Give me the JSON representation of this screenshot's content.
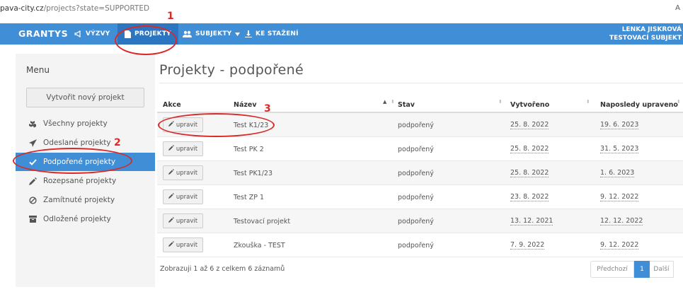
{
  "browser": {
    "url_host": "pava-city.cz",
    "url_path": "/projects?state=SUPPORTED",
    "right_glyph": "A"
  },
  "navbar": {
    "brand": "GRANTYS",
    "items": [
      {
        "label": "VÝZVY",
        "icon": "megaphone-icon"
      },
      {
        "label": "PROJEKTY",
        "icon": "document-icon"
      },
      {
        "label": "SUBJEKTY",
        "icon": "users-icon"
      },
      {
        "label": "KE STAŽENÍ",
        "icon": "download-icon"
      }
    ],
    "user_name": "LENKA JISKROVÁ",
    "user_org": "TESTOVACÍ SUBJEKT"
  },
  "sidebar": {
    "title": "Menu",
    "new_button": "Vytvořit nový projekt",
    "items": [
      {
        "label": "Všechny projekty",
        "icon": "cubes-icon"
      },
      {
        "label": "Odeslané projekty",
        "icon": "send-icon"
      },
      {
        "label": "Podpořené projekty",
        "icon": "check-icon"
      },
      {
        "label": "Rozepsané projekty",
        "icon": "pencil-icon"
      },
      {
        "label": "Zamítnuté projekty",
        "icon": "ban-icon"
      },
      {
        "label": "Odložené projekty",
        "icon": "archive-icon"
      }
    ]
  },
  "main": {
    "title": "Projekty - podpořené",
    "table": {
      "headers": [
        "Akce",
        "Název",
        "Stav",
        "Vytvořeno",
        "Naposledy upraveno"
      ],
      "edit_label": "upravit",
      "rows": [
        {
          "name": "Test K1/23",
          "state": "podpořený",
          "created": "25. 8. 2022",
          "updated": "19. 6. 2023"
        },
        {
          "name": "Test PK 2",
          "state": "podpořený",
          "created": "25. 8. 2022",
          "updated": "31. 5. 2023"
        },
        {
          "name": "Test PK1/23",
          "state": "podpořený",
          "created": "25. 8. 2022",
          "updated": "1. 6. 2023"
        },
        {
          "name": "Test ZP 1",
          "state": "podpořený",
          "created": "23. 8. 2022",
          "updated": "9. 12. 2022"
        },
        {
          "name": "Testovací projekt",
          "state": "podpořený",
          "created": "13. 12. 2021",
          "updated": "12. 12. 2022"
        },
        {
          "name": "Zkouška - TEST",
          "state": "podpořený",
          "created": "7. 9. 2022",
          "updated": "9. 12. 2022"
        }
      ]
    },
    "info": "Zobrazuji 1 až 6 z celkem 6 záznamů",
    "pager": {
      "prev": "Předchozí",
      "current": "1",
      "next": "Další"
    }
  },
  "annotations": {
    "color": "#d92a2a",
    "labels": [
      "1",
      "2",
      "3"
    ]
  },
  "colors": {
    "accent": "#3f8ed6",
    "accent_dark": "#2c76c1"
  }
}
